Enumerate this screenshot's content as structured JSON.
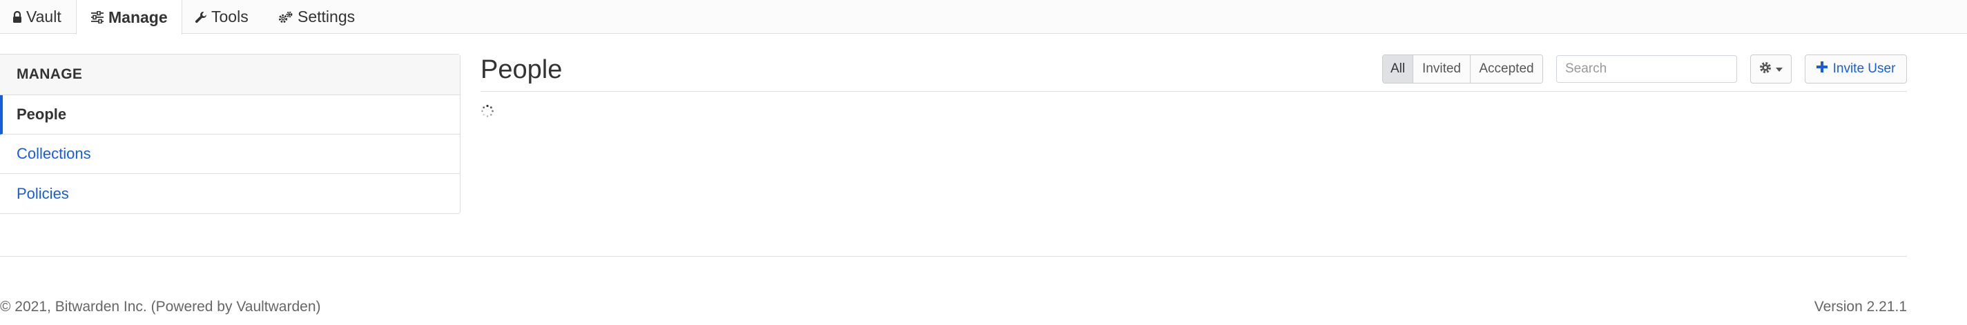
{
  "nav": {
    "tabs": [
      {
        "label": "Vault",
        "icon": "lock-icon"
      },
      {
        "label": "Manage",
        "icon": "sliders-icon",
        "active": true
      },
      {
        "label": "Tools",
        "icon": "wrench-icon"
      },
      {
        "label": "Settings",
        "icon": "cogs-icon"
      }
    ]
  },
  "sidebar": {
    "heading": "MANAGE",
    "items": [
      {
        "label": "People",
        "active": true
      },
      {
        "label": "Collections"
      },
      {
        "label": "Policies"
      }
    ]
  },
  "main": {
    "title": "People",
    "filters": [
      {
        "label": "All",
        "active": true
      },
      {
        "label": "Invited"
      },
      {
        "label": "Accepted"
      }
    ],
    "search": {
      "placeholder": "Search",
      "value": ""
    },
    "invite_label": "Invite User"
  },
  "footer": {
    "copyright": "© 2021, Bitwarden Inc. (Powered by Vaultwarden)",
    "version": "Version 2.21.1"
  },
  "colors": {
    "accent": "#175ddc",
    "text": "#333333",
    "muted": "#666666",
    "border": "#dddddd"
  }
}
